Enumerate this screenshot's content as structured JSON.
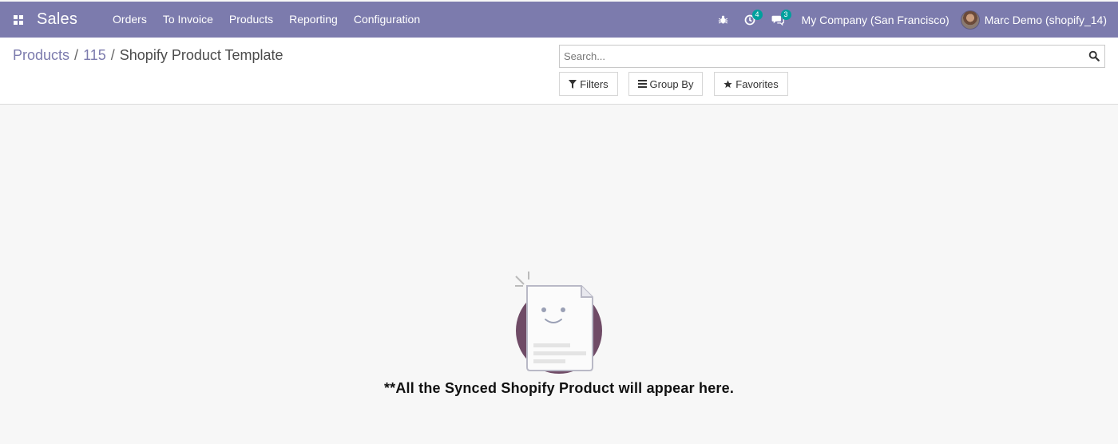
{
  "navbar": {
    "app_name": "Sales",
    "menu": [
      "Orders",
      "To Invoice",
      "Products",
      "Reporting",
      "Configuration"
    ],
    "activity_count": "4",
    "message_count": "3",
    "company": "My Company (San Francisco)",
    "user": "Marc Demo (shopify_14)",
    "icons": [
      "apps-icon",
      "bug-icon",
      "clock-icon",
      "chat-icon"
    ],
    "colors": {
      "navbar_bg": "#7c7bad",
      "badge": "#00a09d"
    }
  },
  "breadcrumb": {
    "items": [
      "Products",
      "115"
    ],
    "separator": "/",
    "current": "Shopify Product Template"
  },
  "search": {
    "placeholder": "Search...",
    "value": ""
  },
  "buttons": {
    "filters": "Filters",
    "group_by": "Group By",
    "favorites": "Favorites"
  },
  "empty_state": {
    "message": "**All the Synced Shopify Product will appear here."
  }
}
